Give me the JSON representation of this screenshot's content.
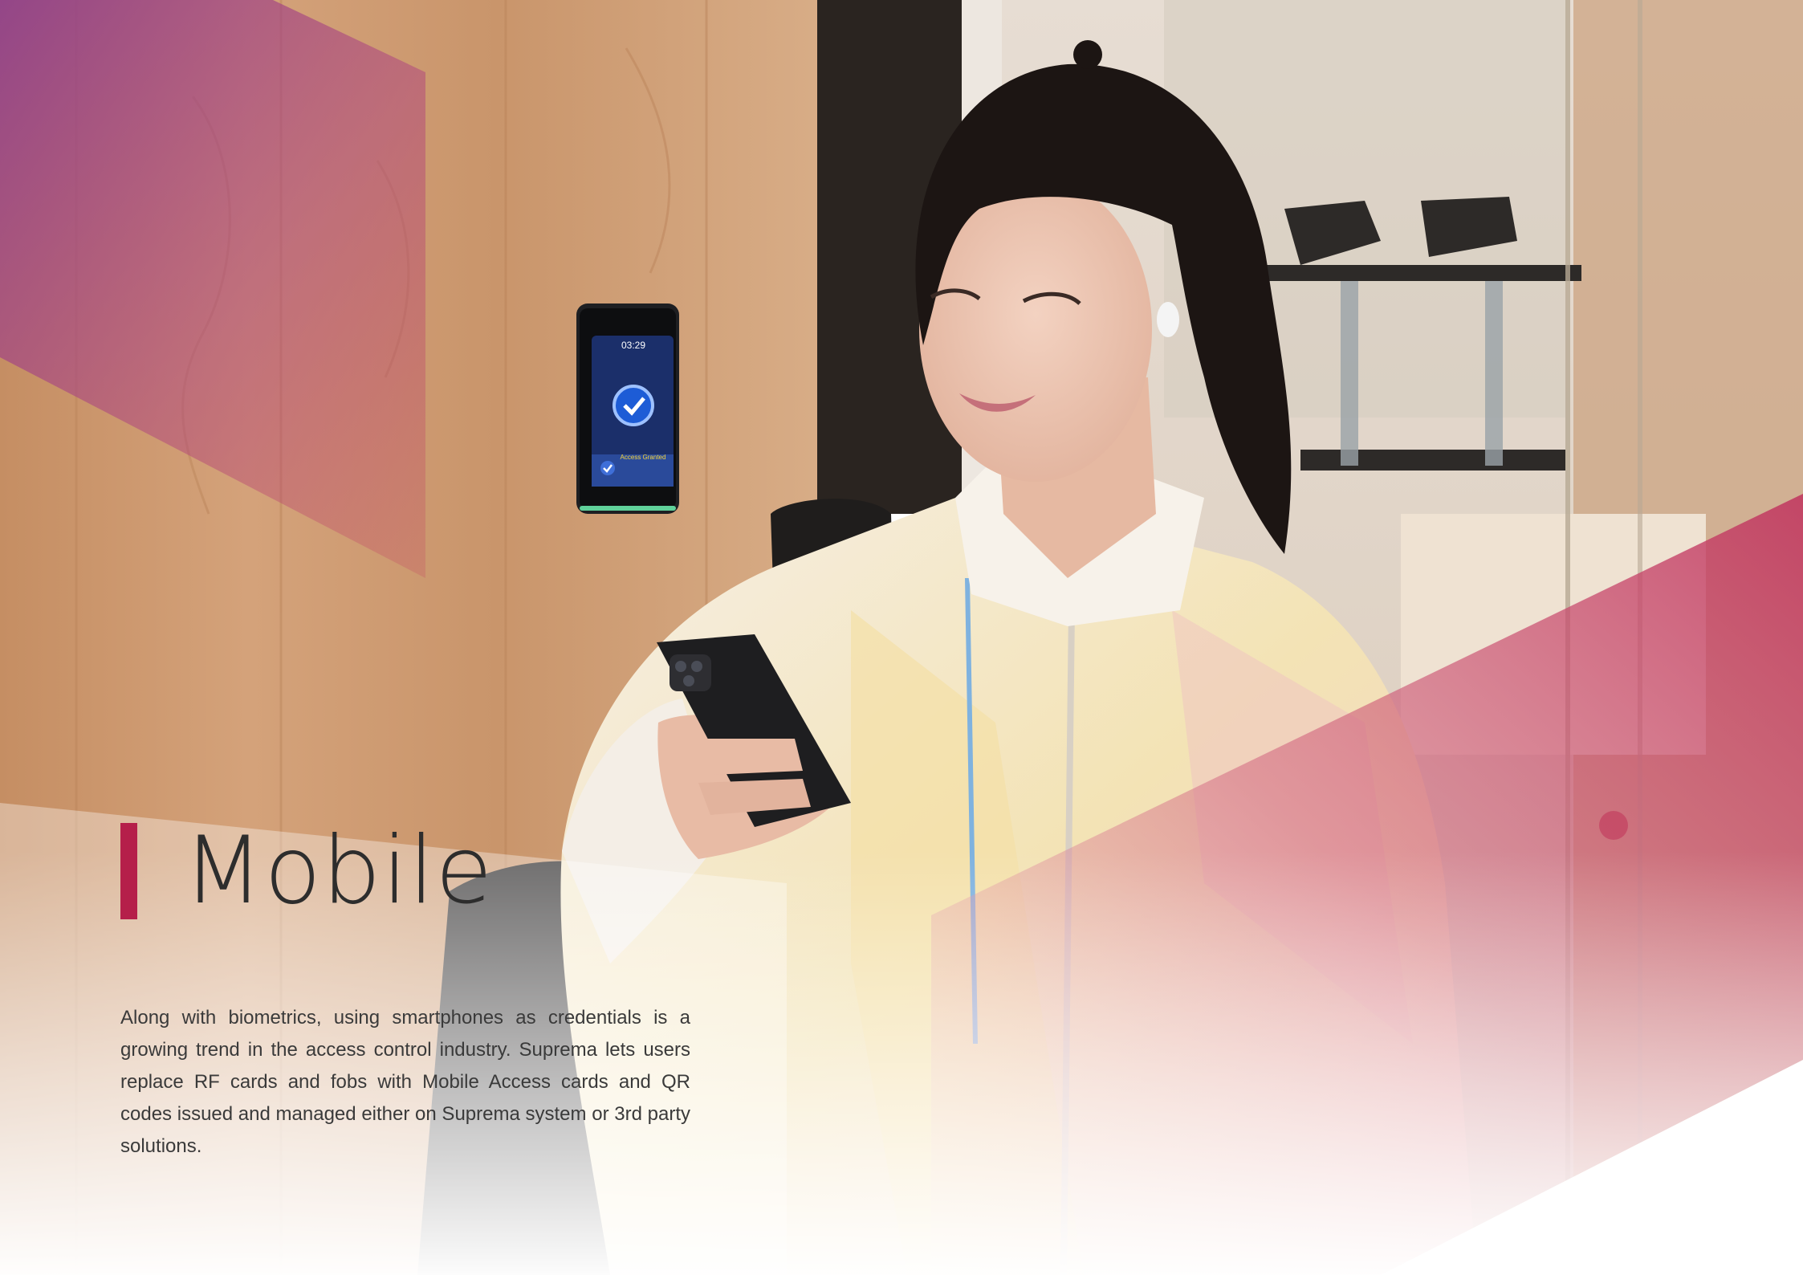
{
  "section": {
    "title": "Mobile",
    "body": "Along with biometrics, using smartphones as credentials is a growing trend in the access control industry. Suprema lets users replace RF cards and fobs with Mobile Access cards and QR codes issued and managed either on Suprema system or 3rd party solutions."
  },
  "device_screen": {
    "time": "03:29",
    "status": "Access Granted"
  },
  "colors": {
    "accent": "#b51f4a",
    "overlay_purple": "#8e3e8c",
    "overlay_magenta": "#c0335e"
  }
}
